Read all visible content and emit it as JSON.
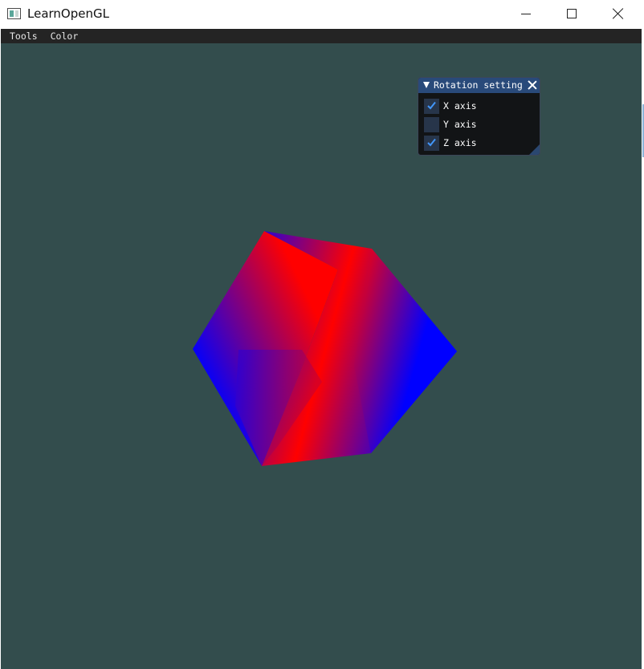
{
  "window": {
    "title": "LearnOpenGL",
    "controls": [
      "minimize-icon",
      "maximize-icon",
      "close-icon"
    ]
  },
  "menubar": {
    "items": [
      {
        "label": "Tools"
      },
      {
        "label": "Color"
      }
    ]
  },
  "rotation_panel": {
    "title": "Rotation setting",
    "checkboxes": [
      {
        "label": "X axis",
        "checked": true
      },
      {
        "label": "Y axis",
        "checked": false
      },
      {
        "label": "Z axis",
        "checked": true
      }
    ]
  },
  "colors": {
    "clear_color": "#334d4d",
    "menubar_bg": "#242424",
    "panel_header": "#294a7a",
    "checkmark": "#4296fa",
    "vertex_red": "#ff0000",
    "vertex_blue": "#0000ff"
  },
  "scene": {
    "object": "rotating cube",
    "shading": "red-blue vertex color gradient"
  }
}
